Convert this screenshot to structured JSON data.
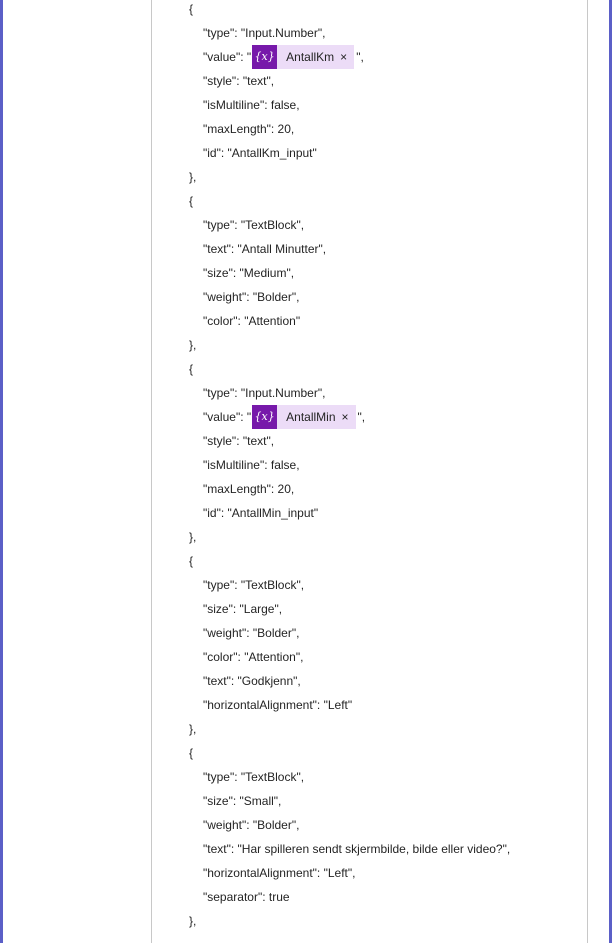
{
  "lines": [
    {
      "indent": 0,
      "text": "{"
    },
    {
      "indent": 1,
      "text": "\"type\": \"Input.Number\","
    },
    {
      "indent": 1,
      "before": "\"value\": \"",
      "token": "AntallKm",
      "after": "\","
    },
    {
      "indent": 1,
      "text": "\"style\": \"text\","
    },
    {
      "indent": 1,
      "text": "\"isMultiline\": false,"
    },
    {
      "indent": 1,
      "text": "\"maxLength\": 20,"
    },
    {
      "indent": 1,
      "text": "\"id\": \"AntallKm_input\""
    },
    {
      "indent": 0,
      "text": "},"
    },
    {
      "indent": 0,
      "text": "{"
    },
    {
      "indent": 1,
      "text": "\"type\": \"TextBlock\","
    },
    {
      "indent": 1,
      "text": "\"text\": \"Antall Minutter\","
    },
    {
      "indent": 1,
      "text": "\"size\": \"Medium\","
    },
    {
      "indent": 1,
      "text": "\"weight\": \"Bolder\","
    },
    {
      "indent": 1,
      "text": "\"color\": \"Attention\""
    },
    {
      "indent": 0,
      "text": "},"
    },
    {
      "indent": 0,
      "text": "{"
    },
    {
      "indent": 1,
      "text": "\"type\": \"Input.Number\","
    },
    {
      "indent": 1,
      "before": "\"value\": \"",
      "token": "AntallMin",
      "after": "\","
    },
    {
      "indent": 1,
      "text": "\"style\": \"text\","
    },
    {
      "indent": 1,
      "text": "\"isMultiline\": false,"
    },
    {
      "indent": 1,
      "text": "\"maxLength\": 20,"
    },
    {
      "indent": 1,
      "text": "\"id\": \"AntallMin_input\""
    },
    {
      "indent": 0,
      "text": "},"
    },
    {
      "indent": 0,
      "text": "{"
    },
    {
      "indent": 1,
      "text": "\"type\": \"TextBlock\","
    },
    {
      "indent": 1,
      "text": "\"size\": \"Large\","
    },
    {
      "indent": 1,
      "text": "\"weight\": \"Bolder\","
    },
    {
      "indent": 1,
      "text": "\"color\": \"Attention\","
    },
    {
      "indent": 1,
      "text": "\"text\": \"Godkjenn\","
    },
    {
      "indent": 1,
      "text": "\"horizontalAlignment\": \"Left\""
    },
    {
      "indent": 0,
      "text": "},"
    },
    {
      "indent": 0,
      "text": "{"
    },
    {
      "indent": 1,
      "text": "\"type\": \"TextBlock\","
    },
    {
      "indent": 1,
      "text": "\"size\": \"Small\","
    },
    {
      "indent": 1,
      "text": "\"weight\": \"Bolder\","
    },
    {
      "indent": 1,
      "text": "\"text\": \"Har spilleren sendt skjermbilde, bilde eller video?\","
    },
    {
      "indent": 1,
      "text": "\"horizontalAlignment\": \"Left\","
    },
    {
      "indent": 1,
      "text": "\"separator\": true"
    },
    {
      "indent": 0,
      "text": "},"
    }
  ],
  "token_icon": "{x}",
  "token_close": "×",
  "colors": {
    "frame_border": "#5b5fc7",
    "token_bg": "#ecdcf7",
    "token_icon_bg": "#7719aa"
  }
}
